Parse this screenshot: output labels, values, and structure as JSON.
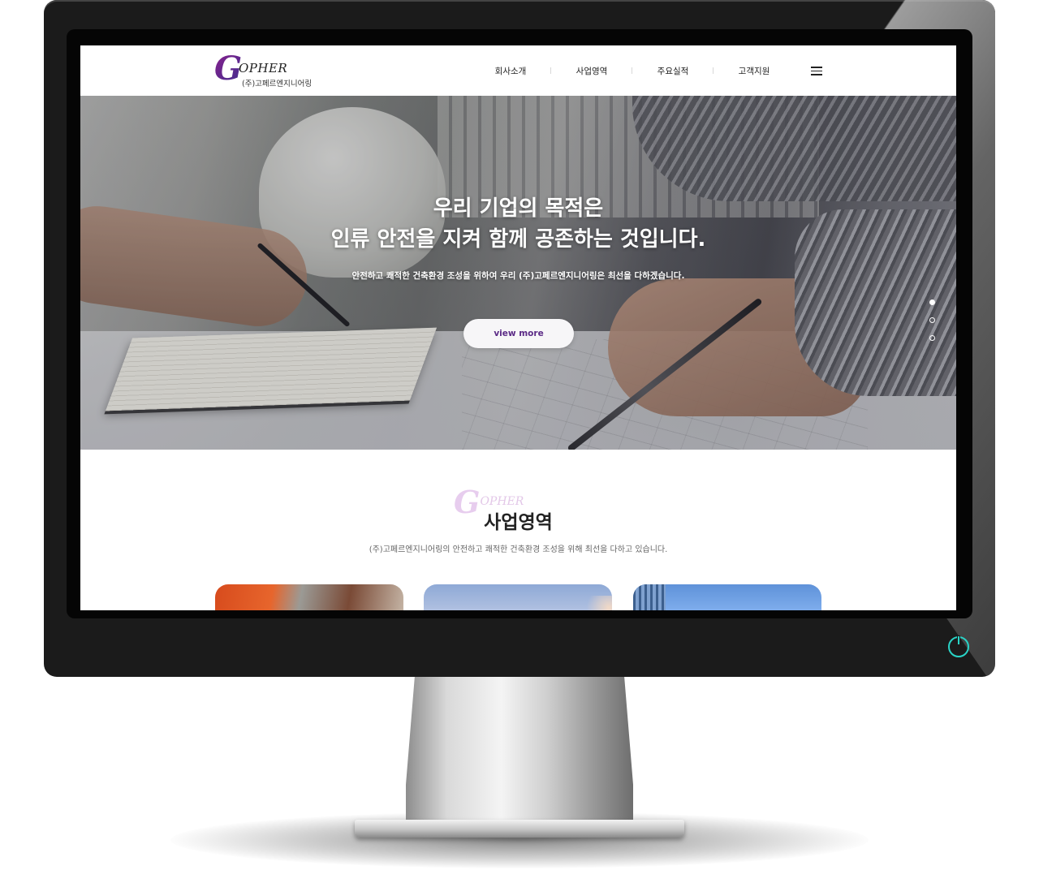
{
  "header": {
    "logo": {
      "initial": "G",
      "word": "OPHER",
      "subtitle": "(주)고페르엔지니어링"
    },
    "nav": [
      {
        "label": "회사소개"
      },
      {
        "label": "사업영역"
      },
      {
        "label": "주요실적"
      },
      {
        "label": "고객지원"
      }
    ],
    "menu_icon": "hamburger-menu-icon"
  },
  "hero": {
    "title_line1": "우리 기업의 목적은",
    "title_line2": "인류 안전을 지켜 함께 공존하는 것입니다.",
    "subtitle": "안전하고 쾌적한 건축환경 조성을 위하여 우리 (주)고페르엔지니어링은 최선을 다하겠습니다.",
    "button_label": "view more",
    "slides_total": 3,
    "active_slide": 1
  },
  "business": {
    "watermark_initial": "G",
    "watermark_word": "OPHER",
    "title": "사업영역",
    "description": "(주)고페르엔지니어링의 안전하고 쾌적한 건축환경 조성을 위해 최선을 다하고 있습니다.",
    "cards": [
      {
        "image": "worker-helmet-photo"
      },
      {
        "image": "sky-sunlight-photo"
      },
      {
        "image": "building-sky-photo"
      }
    ]
  },
  "colors": {
    "brand_purple": "#5b2a86",
    "power_led": "#29d3c6",
    "bezel": "#1b1b1b"
  }
}
